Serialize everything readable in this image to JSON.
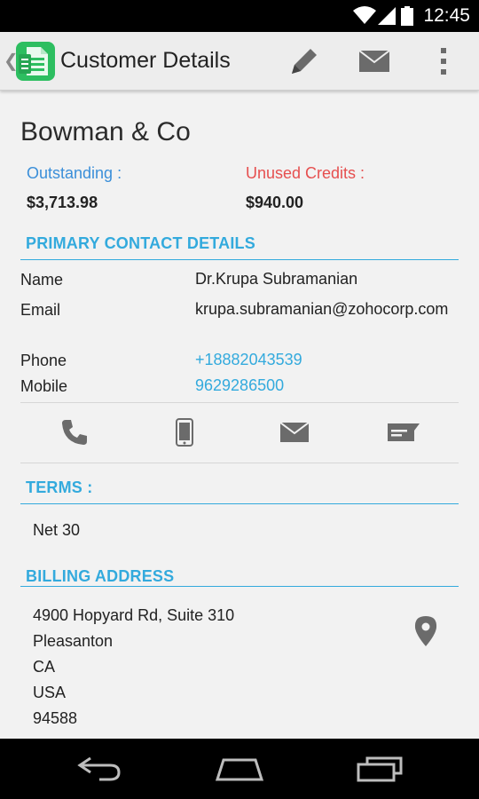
{
  "status_bar": {
    "time": "12:45"
  },
  "action_bar": {
    "title": "Customer Details"
  },
  "customer": {
    "name": "Bowman & Co",
    "outstanding_label": "Outstanding :",
    "outstanding_value": "$3,713.98",
    "unused_credits_label": "Unused Credits :",
    "unused_credits_value": "$940.00"
  },
  "primary_contact": {
    "section_title": "PRIMARY CONTACT DETAILS",
    "name_label": "Name",
    "name_value": "Dr.Krupa Subramanian",
    "email_label": "Email",
    "email_value": "krupa.subramanian@zohocorp.com",
    "phone_label": "Phone",
    "phone_value": "+18882043539",
    "mobile_label": "Mobile",
    "mobile_value": "9629286500"
  },
  "terms": {
    "section_title": "TERMS :",
    "value": "Net 30"
  },
  "billing_address": {
    "section_title": "BILLING ADDRESS",
    "street": "4900 Hopyard Rd, Suite 310",
    "city": "Pleasanton",
    "state": "CA",
    "country": "USA",
    "zip": "94588"
  },
  "colors": {
    "accent": "#33aadd",
    "outstanding": "#3b8fd9",
    "unused_credits": "#e64f4f",
    "app_icon": "#2dbe60",
    "icon_gray": "#6b6b6b"
  }
}
